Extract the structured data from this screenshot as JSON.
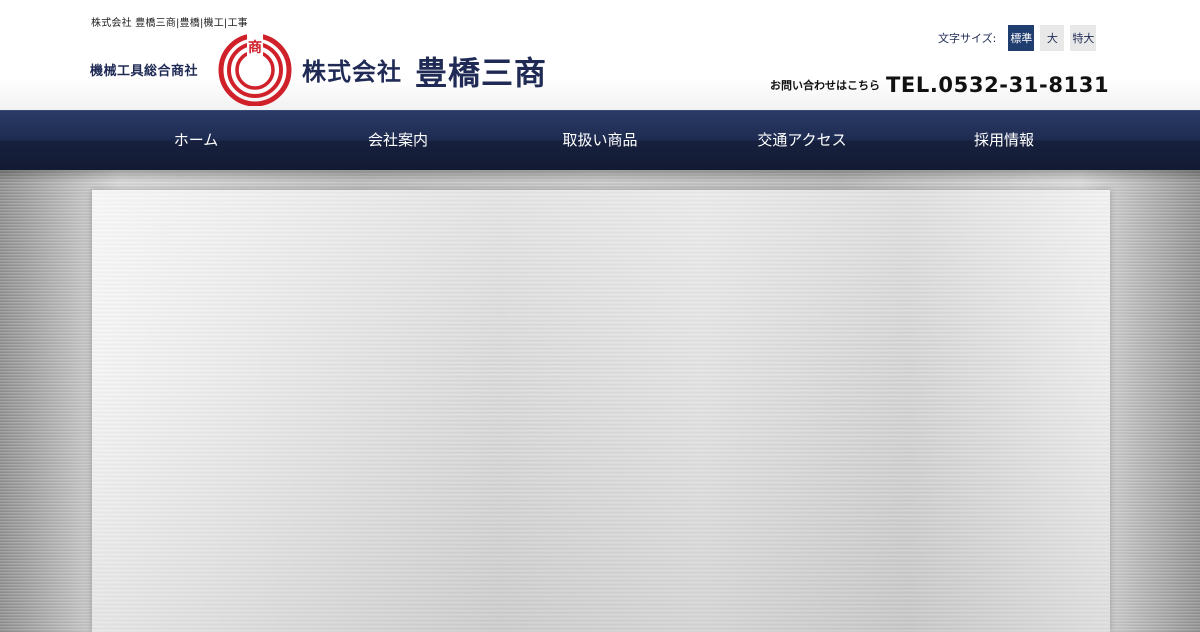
{
  "header": {
    "tagline": "株式会社 豊橋三商|豊橋|機工|工事",
    "logo": {
      "subtitle": "機械工具総合商社",
      "mark_text": "商",
      "company_prefix": "株式会社",
      "company_name": "豊橋三商",
      "mark_color": "#d0202a",
      "text_color": "#1f2a55"
    },
    "font_size": {
      "label": "文字サイズ:",
      "options": [
        "標準",
        "大",
        "特大"
      ],
      "selected": "標準"
    },
    "contact": {
      "label": "お問い合わせはこちら",
      "tel": "TEL.0532-31-8131"
    }
  },
  "nav": {
    "items": [
      {
        "label": "ホーム"
      },
      {
        "label": "会社案内"
      },
      {
        "label": "取扱い商品"
      },
      {
        "label": "交通アクセス"
      },
      {
        "label": "採用情報"
      }
    ],
    "background": "#1f2c52"
  },
  "main": {
    "accent": "#1f3d6e"
  }
}
